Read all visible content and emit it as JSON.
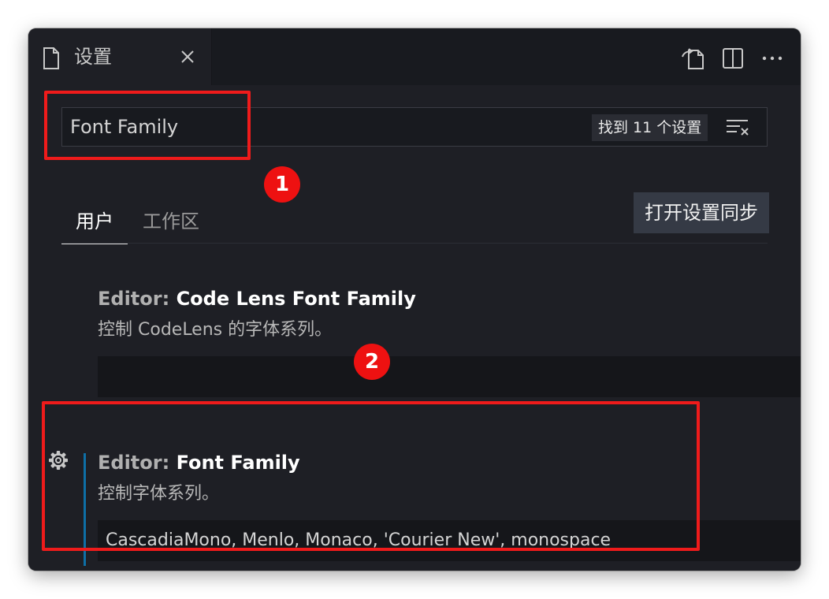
{
  "tab": {
    "title": "设置",
    "icon": "file-icon"
  },
  "toolbar": {
    "icons": [
      "open-settings-json-icon",
      "split-editor-icon",
      "more-actions-icon"
    ]
  },
  "search": {
    "value": "Font Family",
    "result_count": "找到 11 个设置"
  },
  "scopes": [
    {
      "label": "用户",
      "active": true
    },
    {
      "label": "工作区",
      "active": false
    }
  ],
  "sync_button": "打开设置同步",
  "settings": [
    {
      "category": "Editor: ",
      "name": "Code Lens Font Family",
      "description": "控制 CodeLens 的字体系列。",
      "value": ""
    },
    {
      "category": "Editor: ",
      "name": "Font Family",
      "description": "控制字体系列。",
      "value": "CascadiaMono, Menlo, Monaco, 'Courier New', monospace"
    }
  ],
  "annotations": [
    "1",
    "2"
  ],
  "colors": {
    "annotation_red": "#ee1111",
    "modified_indicator": "#0e6fa6",
    "background": "#1e1f25"
  }
}
